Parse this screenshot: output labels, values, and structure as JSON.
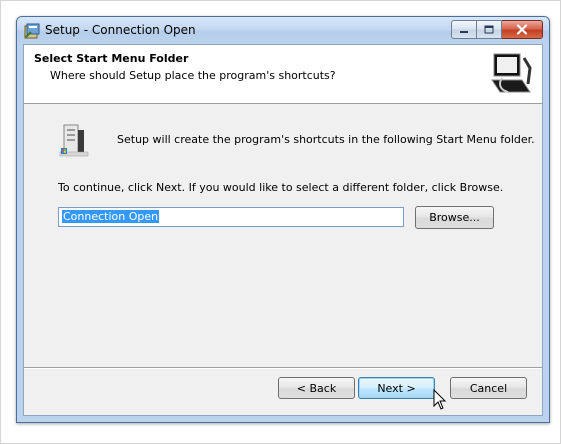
{
  "window": {
    "title": "Setup - Connection Open",
    "controls": {
      "minimize": "minimize",
      "maximize": "maximize",
      "close": "close"
    }
  },
  "header": {
    "title": "Select Start Menu Folder",
    "subtitle": "Where should Setup place the program's shortcuts?"
  },
  "body": {
    "info": "Setup will create the program's shortcuts in the following Start Menu folder.",
    "continue_text": "To continue, click Next. If you would like to select a different folder, click Browse.",
    "folder_value": "Connection Open",
    "browse_label": "Browse..."
  },
  "footer": {
    "back_label": "< Back",
    "next_label": "Next >",
    "cancel_label": "Cancel"
  },
  "icons": [
    "setup-app-icon",
    "installer-computer-icon",
    "start-menu-folder-icon",
    "minimize-icon",
    "maximize-icon",
    "close-icon",
    "mouse-cursor-icon"
  ],
  "colors": {
    "selection": "#3399ff",
    "close_button": "#c33f23",
    "title_bar": "#bcd3ee"
  }
}
